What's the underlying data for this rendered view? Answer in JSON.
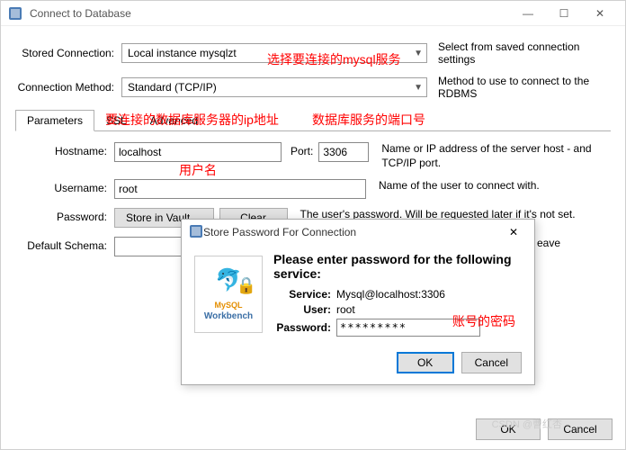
{
  "window": {
    "title": "Connect to Database",
    "minimize": "—",
    "maximize": "☐",
    "close": "✕"
  },
  "stored": {
    "label": "Stored Connection:",
    "value": "Local instance mysqlzt",
    "desc": "Select from saved connection settings"
  },
  "method": {
    "label": "Connection Method:",
    "value": "Standard (TCP/IP)",
    "desc": "Method to use to connect to the RDBMS"
  },
  "tabs": {
    "parameters": "Parameters",
    "ssl": "SSL",
    "advanced": "Advanced"
  },
  "hostname": {
    "label": "Hostname:",
    "value": "localhost",
    "port_label": "Port:",
    "port_value": "3306",
    "help": "Name or IP address of the server host - and TCP/IP port."
  },
  "username": {
    "label": "Username:",
    "value": "root",
    "help": "Name of the user to connect with."
  },
  "password": {
    "label": "Password:",
    "store_btn": "Store in Vault ...",
    "clear_btn": "Clear",
    "help": "The user's password. Will be requested later if it's not set."
  },
  "schema": {
    "label": "Default Schema:",
    "value": "",
    "help_suffix": "eave"
  },
  "buttons": {
    "ok": "OK",
    "cancel": "Cancel"
  },
  "modal": {
    "title": "Store Password For Connection",
    "close": "✕",
    "heading": "Please enter password for the following service:",
    "service_label": "Service:",
    "service_value": "Mysql@localhost:3306",
    "user_label": "User:",
    "user_value": "root",
    "password_label": "Password:",
    "password_value": "*********",
    "logo_mysql": "MySQL",
    "logo_wb": "Workbench",
    "ok": "OK",
    "cancel": "Cancel"
  },
  "annotations": {
    "a1": "选择要连接的mysql服务",
    "a2": "要连接的数据库服务器的ip地址",
    "a3": "数据库服务的端口号",
    "a4": "用户名",
    "a5": "账号的密码"
  },
  "watermark": "CSDN @曹红杏"
}
